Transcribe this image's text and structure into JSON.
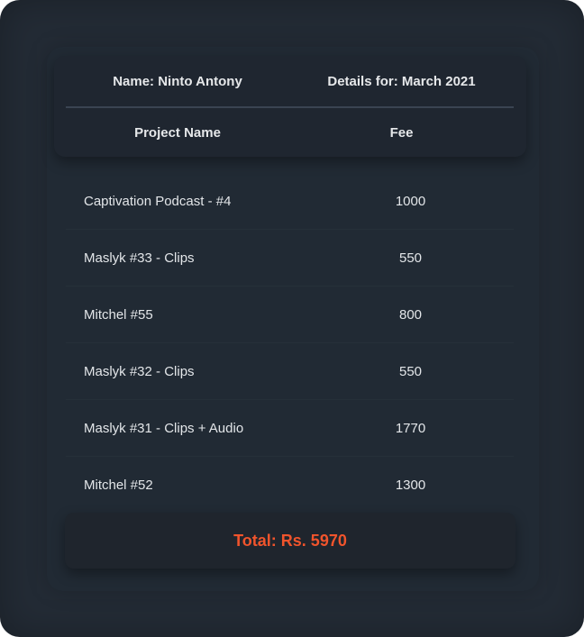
{
  "header": {
    "name": "Name: Ninto Antony",
    "details": "Details for: March 2021",
    "col_project": "Project Name",
    "col_fee": "Fee"
  },
  "projects": [
    {
      "name": "Captivation Podcast - #4",
      "fee": "1000"
    },
    {
      "name": "Maslyk #33 - Clips",
      "fee": "550"
    },
    {
      "name": "Mitchel #55",
      "fee": "800"
    },
    {
      "name": "Maslyk #32 - Clips",
      "fee": "550"
    },
    {
      "name": "Maslyk #31 - Clips + Audio",
      "fee": "1770"
    },
    {
      "name": "Mitchel #52",
      "fee": "1300"
    }
  ],
  "total": "Total: Rs. 5970",
  "colors": {
    "background": "#232b35",
    "text": "#e3e6e9",
    "total": "#f0542c"
  }
}
